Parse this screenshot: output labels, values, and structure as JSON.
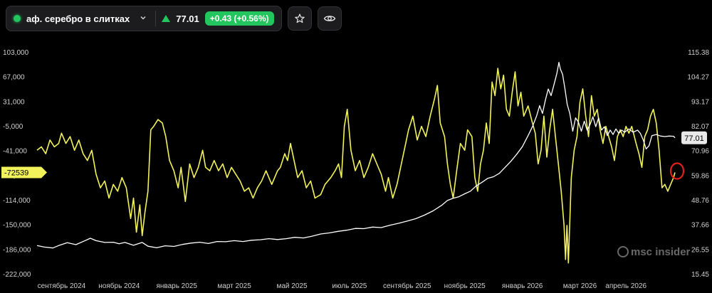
{
  "toolbar": {
    "instrument_name": "аф. серебро в слитках",
    "price": "77.01",
    "change": "+0.43 (+0.56%)",
    "icons": [
      "chevron-down-icon",
      "up-triangle-icon",
      "star-icon",
      "eye-icon"
    ]
  },
  "watermark": "msc insider",
  "colors": {
    "background": "#000000",
    "yellow_series": "#f2f25a",
    "white_series": "#ffffff",
    "positive": "#22c55e",
    "marker": "#e0201c"
  },
  "chart_data": {
    "type": "line",
    "x_labels": [
      "сентябрь 2024",
      "ноябрь 2024",
      "январь 2025",
      "март 2025",
      "май 2025",
      "июль 2025",
      "сентябрь 2025",
      "ноябрь 2025",
      "январь 2026",
      "март 2026",
      "апрель 2026"
    ],
    "x_tick_pos": [
      0,
      2,
      4,
      6,
      8,
      10,
      12,
      14,
      16,
      18,
      19.6
    ],
    "x_range": [
      -0.9,
      20.5
    ],
    "y_left_ticks": [
      "103,000",
      "67,000",
      "31,000",
      "-5,000",
      "-41,000",
      "-78,000",
      "-114,000",
      "-150,000",
      "-186,000",
      "-222,000"
    ],
    "y_left_range": [
      -222000,
      103000
    ],
    "y_right_ticks": [
      "115.38",
      "104.27",
      "93.17",
      "82.07",
      "70.96",
      "59.86",
      "48.76",
      "37.66",
      "26.55",
      "15.45"
    ],
    "y_right_range": [
      15.45,
      115.38
    ],
    "left_last_label": "-72539",
    "right_last_label": "77.01",
    "left_last_value": -72539,
    "right_last_value": 77.01,
    "series": [
      {
        "axis": "left",
        "color": "#f2f25a",
        "points": [
          [
            -0.85,
            -40000
          ],
          [
            -0.7,
            -35000
          ],
          [
            -0.55,
            -45000
          ],
          [
            -0.4,
            -25000
          ],
          [
            -0.25,
            -35000
          ],
          [
            -0.1,
            -30000
          ],
          [
            0.0,
            -15000
          ],
          [
            0.15,
            -30000
          ],
          [
            0.3,
            -20000
          ],
          [
            0.45,
            -40000
          ],
          [
            0.6,
            -25000
          ],
          [
            0.75,
            -45000
          ],
          [
            0.9,
            -55000
          ],
          [
            1.05,
            -40000
          ],
          [
            1.2,
            -75000
          ],
          [
            1.35,
            -95000
          ],
          [
            1.5,
            -85000
          ],
          [
            1.65,
            -110000
          ],
          [
            1.8,
            -90000
          ],
          [
            1.95,
            -100000
          ],
          [
            2.1,
            -80000
          ],
          [
            2.25,
            -95000
          ],
          [
            2.4,
            -140000
          ],
          [
            2.5,
            -110000
          ],
          [
            2.6,
            -160000
          ],
          [
            2.72,
            -120000
          ],
          [
            2.8,
            -165000
          ],
          [
            2.9,
            -130000
          ],
          [
            3.0,
            -100000
          ],
          [
            3.1,
            -10000
          ],
          [
            3.2,
            -5000
          ],
          [
            3.35,
            5000
          ],
          [
            3.5,
            0
          ],
          [
            3.62,
            -20000
          ],
          [
            3.75,
            -55000
          ],
          [
            3.9,
            -70000
          ],
          [
            4.05,
            -95000
          ],
          [
            4.15,
            -65000
          ],
          [
            4.3,
            -115000
          ],
          [
            4.45,
            -60000
          ],
          [
            4.6,
            -80000
          ],
          [
            4.75,
            -65000
          ],
          [
            4.9,
            -40000
          ],
          [
            5.0,
            -65000
          ],
          [
            5.15,
            -70000
          ],
          [
            5.3,
            -55000
          ],
          [
            5.45,
            -70000
          ],
          [
            5.6,
            -60000
          ],
          [
            5.75,
            -80000
          ],
          [
            5.9,
            -65000
          ],
          [
            6.05,
            -75000
          ],
          [
            6.2,
            -85000
          ],
          [
            6.35,
            -100000
          ],
          [
            6.5,
            -95000
          ],
          [
            6.65,
            -110000
          ],
          [
            6.8,
            -95000
          ],
          [
            6.95,
            -85000
          ],
          [
            7.1,
            -70000
          ],
          [
            7.3,
            -90000
          ],
          [
            7.5,
            -70000
          ],
          [
            7.6,
            -65000
          ],
          [
            7.75,
            -45000
          ],
          [
            7.85,
            -55000
          ],
          [
            7.95,
            -30000
          ],
          [
            8.05,
            -50000
          ],
          [
            8.2,
            -80000
          ],
          [
            8.35,
            -70000
          ],
          [
            8.5,
            -95000
          ],
          [
            8.65,
            -85000
          ],
          [
            8.8,
            -110000
          ],
          [
            9.0,
            -105000
          ],
          [
            9.15,
            -90000
          ],
          [
            9.35,
            -80000
          ],
          [
            9.5,
            -70000
          ],
          [
            9.62,
            -60000
          ],
          [
            9.72,
            -80000
          ],
          [
            9.82,
            -5000
          ],
          [
            9.92,
            20000
          ],
          [
            10.05,
            -40000
          ],
          [
            10.2,
            -70000
          ],
          [
            10.35,
            -55000
          ],
          [
            10.5,
            -80000
          ],
          [
            10.65,
            -65000
          ],
          [
            10.8,
            -45000
          ],
          [
            10.95,
            -60000
          ],
          [
            11.1,
            -75000
          ],
          [
            11.25,
            -100000
          ],
          [
            11.35,
            -80000
          ],
          [
            11.5,
            -110000
          ],
          [
            11.65,
            -90000
          ],
          [
            11.8,
            -60000
          ],
          [
            11.95,
            -30000
          ],
          [
            12.05,
            -10000
          ],
          [
            12.2,
            10000
          ],
          [
            12.35,
            -25000
          ],
          [
            12.5,
            -5000
          ],
          [
            12.65,
            -20000
          ],
          [
            12.8,
            10000
          ],
          [
            12.95,
            35000
          ],
          [
            13.05,
            55000
          ],
          [
            13.15,
            0
          ],
          [
            13.3,
            -20000
          ],
          [
            13.4,
            -60000
          ],
          [
            13.5,
            -90000
          ],
          [
            13.6,
            -110000
          ],
          [
            13.72,
            -70000
          ],
          [
            13.85,
            -30000
          ],
          [
            14.0,
            -40000
          ],
          [
            14.1,
            -10000
          ],
          [
            14.25,
            -20000
          ],
          [
            14.35,
            -80000
          ],
          [
            14.45,
            -100000
          ],
          [
            14.55,
            -60000
          ],
          [
            14.65,
            -40000
          ],
          [
            14.75,
            0
          ],
          [
            14.85,
            -30000
          ],
          [
            14.95,
            60000
          ],
          [
            15.05,
            40000
          ],
          [
            15.15,
            80000
          ],
          [
            15.25,
            50000
          ],
          [
            15.35,
            70000
          ],
          [
            15.45,
            20000
          ],
          [
            15.55,
            10000
          ],
          [
            15.65,
            45000
          ],
          [
            15.75,
            75000
          ],
          [
            15.85,
            25000
          ],
          [
            15.95,
            45000
          ],
          [
            16.05,
            10000
          ],
          [
            16.2,
            25000
          ],
          [
            16.35,
            0
          ],
          [
            16.45,
            -15000
          ],
          [
            16.55,
            -60000
          ],
          [
            16.65,
            -40000
          ],
          [
            16.75,
            10000
          ],
          [
            16.85,
            -50000
          ],
          [
            16.95,
            -10000
          ],
          [
            17.05,
            20000
          ],
          [
            17.15,
            -20000
          ],
          [
            17.25,
            -60000
          ],
          [
            17.35,
            -100000
          ],
          [
            17.45,
            -150000
          ],
          [
            17.5,
            -200000
          ],
          [
            17.55,
            -150000
          ],
          [
            17.6,
            -205000
          ],
          [
            17.7,
            -80000
          ],
          [
            17.8,
            -40000
          ],
          [
            17.9,
            -20000
          ],
          [
            18.0,
            30000
          ],
          [
            18.1,
            50000
          ],
          [
            18.2,
            10000
          ],
          [
            18.3,
            -20000
          ],
          [
            18.4,
            40000
          ],
          [
            18.5,
            10000
          ],
          [
            18.6,
            20000
          ],
          [
            18.7,
            -10000
          ],
          [
            18.8,
            -30000
          ],
          [
            18.9,
            -5000
          ],
          [
            19.0,
            -20000
          ],
          [
            19.1,
            -35000
          ],
          [
            19.2,
            -55000
          ],
          [
            19.3,
            -20000
          ],
          [
            19.4,
            -10000
          ],
          [
            19.5,
            -20000
          ],
          [
            19.6,
            -5000
          ],
          [
            19.7,
            -15000
          ],
          [
            19.8,
            -5000
          ],
          [
            19.95,
            -30000
          ],
          [
            20.05,
            -45000
          ],
          [
            20.15,
            -65000
          ],
          [
            20.25,
            -20000
          ],
          [
            20.35,
            -10000
          ],
          [
            20.45,
            10000
          ],
          [
            20.55,
            20000
          ],
          [
            20.65,
            0
          ],
          [
            20.75,
            -40000
          ],
          [
            20.85,
            -95000
          ],
          [
            20.95,
            -90000
          ],
          [
            21.05,
            -100000
          ],
          [
            21.15,
            -90000
          ],
          [
            21.25,
            -80000
          ],
          [
            21.3,
            -72539
          ]
        ]
      },
      {
        "axis": "right",
        "color": "#ffffff",
        "points": [
          [
            -0.85,
            28.5
          ],
          [
            -0.6,
            27.8
          ],
          [
            -0.3,
            27.4
          ],
          [
            -0.1,
            28.5
          ],
          [
            0.2,
            29.8
          ],
          [
            0.5,
            28.9
          ],
          [
            0.8,
            30.6
          ],
          [
            1.0,
            31.8
          ],
          [
            1.2,
            30.7
          ],
          [
            1.5,
            29.9
          ],
          [
            1.8,
            30.0
          ],
          [
            2.0,
            29.3
          ],
          [
            2.2,
            29.9
          ],
          [
            2.5,
            28.6
          ],
          [
            2.8,
            29.9
          ],
          [
            3.0,
            28.2
          ],
          [
            3.3,
            27.5
          ],
          [
            3.6,
            28.4
          ],
          [
            3.9,
            28.1
          ],
          [
            4.2,
            29.0
          ],
          [
            4.5,
            29.6
          ],
          [
            4.8,
            30.0
          ],
          [
            5.1,
            29.4
          ],
          [
            5.4,
            30.3
          ],
          [
            5.7,
            30.2
          ],
          [
            6.0,
            30.7
          ],
          [
            6.3,
            30.3
          ],
          [
            6.6,
            30.9
          ],
          [
            6.9,
            31.1
          ],
          [
            7.2,
            31.6
          ],
          [
            7.5,
            31.2
          ],
          [
            7.8,
            31.6
          ],
          [
            8.1,
            32.2
          ],
          [
            8.4,
            31.9
          ],
          [
            8.7,
            32.7
          ],
          [
            9.0,
            33.7
          ],
          [
            9.3,
            34.2
          ],
          [
            9.6,
            34.9
          ],
          [
            9.9,
            35.4
          ],
          [
            10.2,
            36.2
          ],
          [
            10.5,
            36.1
          ],
          [
            10.8,
            36.8
          ],
          [
            11.1,
            36.6
          ],
          [
            11.4,
            37.6
          ],
          [
            11.7,
            38.5
          ],
          [
            12.0,
            39.5
          ],
          [
            12.3,
            40.6
          ],
          [
            12.6,
            42.2
          ],
          [
            12.9,
            44.1
          ],
          [
            13.2,
            46.6
          ],
          [
            13.4,
            48.8
          ],
          [
            13.6,
            49.8
          ],
          [
            13.8,
            50.5
          ],
          [
            14.0,
            51.8
          ],
          [
            14.2,
            53.0
          ],
          [
            14.4,
            55.4
          ],
          [
            14.6,
            57.0
          ],
          [
            14.8,
            58.8
          ],
          [
            15.0,
            59.5
          ],
          [
            15.2,
            61.0
          ],
          [
            15.4,
            63.7
          ],
          [
            15.6,
            66.4
          ],
          [
            15.8,
            69.5
          ],
          [
            16.0,
            73.0
          ],
          [
            16.2,
            78.0
          ],
          [
            16.35,
            82.0
          ],
          [
            16.5,
            87.0
          ],
          [
            16.6,
            91.5
          ],
          [
            16.7,
            88.0
          ],
          [
            16.8,
            94.0
          ],
          [
            16.9,
            99.0
          ],
          [
            17.0,
            96.0
          ],
          [
            17.1,
            101.0
          ],
          [
            17.2,
            106.0
          ],
          [
            17.27,
            111.0
          ],
          [
            17.32,
            108.0
          ],
          [
            17.4,
            105.5
          ],
          [
            17.48,
            99.0
          ],
          [
            17.56,
            92.0
          ],
          [
            17.65,
            88.0
          ],
          [
            17.75,
            80.0
          ],
          [
            17.85,
            86.0
          ],
          [
            17.95,
            84.0
          ],
          [
            18.05,
            80.0
          ],
          [
            18.15,
            84.5
          ],
          [
            18.25,
            80.5
          ],
          [
            18.35,
            83.0
          ],
          [
            18.45,
            86.5
          ],
          [
            18.55,
            82.0
          ],
          [
            18.65,
            86.0
          ],
          [
            18.75,
            80.5
          ],
          [
            18.85,
            82.0
          ],
          [
            18.95,
            78.0
          ],
          [
            19.05,
            80.5
          ],
          [
            19.15,
            78.5
          ],
          [
            19.25,
            81.0
          ],
          [
            19.35,
            79.0
          ],
          [
            19.45,
            80.5
          ],
          [
            19.55,
            79.5
          ],
          [
            19.7,
            81.0
          ],
          [
            19.85,
            79.5
          ],
          [
            20.0,
            80.5
          ],
          [
            20.1,
            79.0
          ],
          [
            20.2,
            76.0
          ],
          [
            20.3,
            72.0
          ],
          [
            20.4,
            73.5
          ],
          [
            20.5,
            78.0
          ],
          [
            20.65,
            78.5
          ],
          [
            20.8,
            77.8
          ],
          [
            20.95,
            77.6
          ],
          [
            21.1,
            77.8
          ],
          [
            21.25,
            77.7
          ],
          [
            21.3,
            77.01
          ]
        ]
      }
    ]
  }
}
